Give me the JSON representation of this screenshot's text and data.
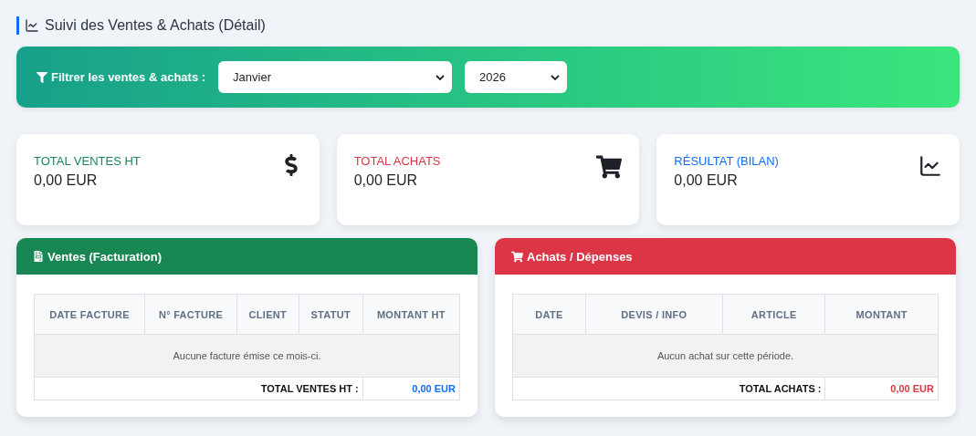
{
  "page_title": "Suivi des Ventes & Achats (Détail)",
  "filter": {
    "label": "Filtrer les ventes & achats :",
    "month": "Janvier",
    "year": "2026"
  },
  "summary_cards": [
    {
      "label": "TOTAL VENTES HT",
      "value": "0,00 EUR",
      "color": "#198754",
      "kind": "dollar"
    },
    {
      "label": "TOTAL ACHATS",
      "value": "0,00 EUR",
      "color": "#dc3545",
      "kind": "cart"
    },
    {
      "label": "RÉSULTAT (BILAN)",
      "value": "0,00 EUR",
      "color": "#0d6efd",
      "kind": "chart"
    }
  ],
  "panels": [
    {
      "title": "Ventes (Facturation)",
      "kind": "invoice",
      "color": "#198754",
      "columns": [
        "DATE FACTURE",
        "N° FACTURE",
        "CLIENT",
        "STATUT",
        "MONTANT HT"
      ],
      "empty_message": "Aucune facture émise ce mois-ci.",
      "total_label": "TOTAL VENTES HT :",
      "total_value": "0,00 EUR"
    },
    {
      "title": "Achats / Dépenses",
      "kind": "cart",
      "color": "#dc3545",
      "columns": [
        "DATE",
        "DEVIS / INFO",
        "ARTICLE",
        "MONTANT"
      ],
      "empty_message": "Aucun achat sur cette période.",
      "total_label": "TOTAL ACHATS :",
      "total_value": "0,00 EUR"
    }
  ]
}
